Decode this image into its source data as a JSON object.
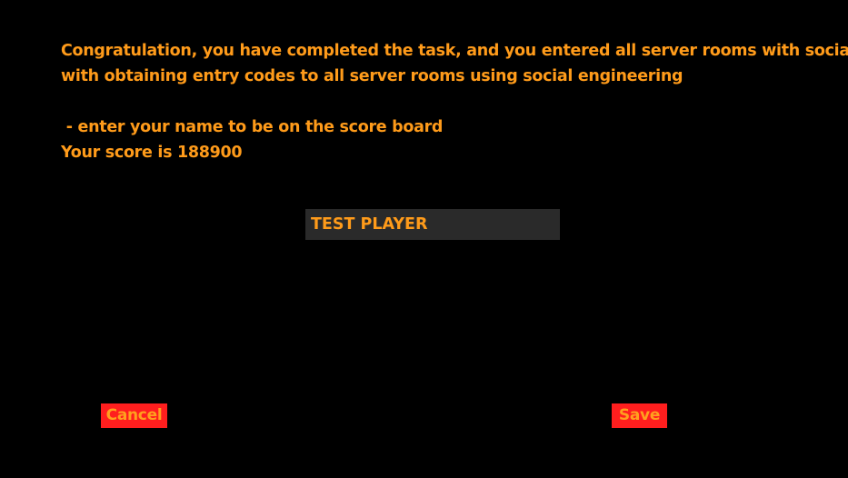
{
  "message": {
    "line1": "Congratulation, you have completed the task, and you entered all server rooms with social",
    "line2": "with obtaining entry codes to all server rooms using social engineering",
    "line3": "",
    "line4": " - enter your name to be on the score board",
    "line5": "Your score is 188900"
  },
  "name_input": {
    "value": "TEST PLAYER"
  },
  "buttons": {
    "cancel_label": "Cancel",
    "save_label": "Save"
  },
  "colors": {
    "background": "#000000",
    "text": "#ff9b1a",
    "input_bg": "#2a2a2a",
    "button_bg": "#ff1e1e"
  }
}
